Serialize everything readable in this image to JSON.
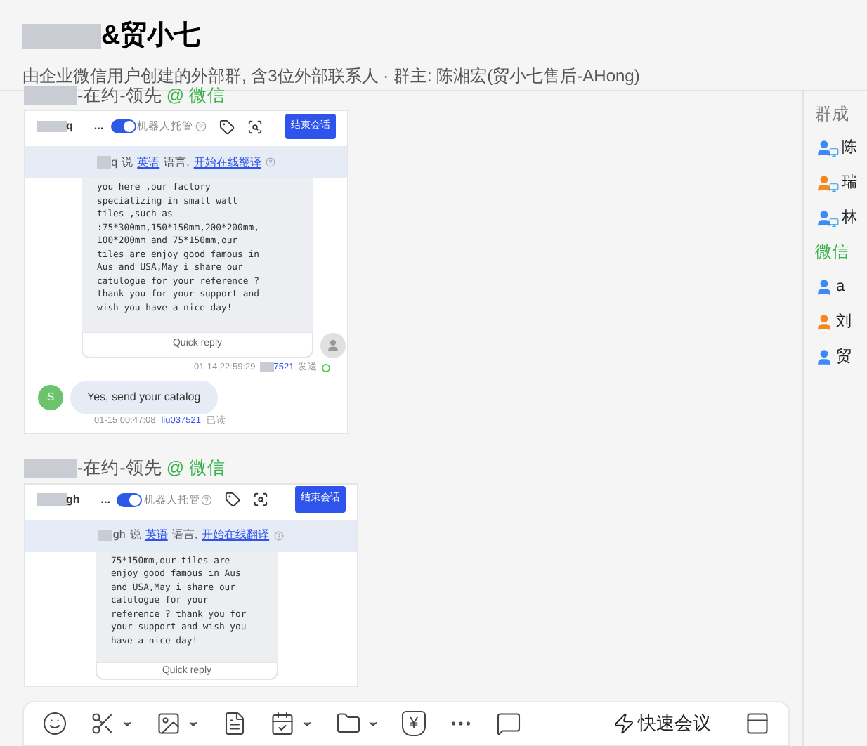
{
  "header": {
    "title": "&贸小七",
    "subtitle": "由企业微信用户创建的外部群, 含3位外部联系人 · 群主: 陈湘宏(贸小七售后-AHong)"
  },
  "posts": [
    {
      "sender": "-在约-领先",
      "channel": "@ 微信",
      "shot": {
        "contact": "q",
        "more": "...",
        "robot_on": true,
        "robot_label": "机器人托管",
        "end_button": "结束会话",
        "translate": {
          "name": "q",
          "says": "说",
          "language": "英语",
          "suffix": "语言,",
          "link": "开始在线翻译"
        },
        "lines": [
          "you here ,our factory",
          "specializing in small wall",
          "tiles ,such as",
          ":75*300mm,150*150mm,200*200mm,",
          "100*200mm and 75*150mm,our",
          "tiles are enjoy good famous in",
          "Aus and USA,May i share our",
          "catulogue for your reference ?",
          "thank you for your support and",
          "wish you have a nice day!"
        ],
        "quick_reply": "Quick reply",
        "meta": {
          "time": "01-14 22:59:29",
          "agent": "7521",
          "status": "发送"
        },
        "reply": {
          "avatar": "S",
          "text": "Yes, send your catalog",
          "time": "01-15 00:47:08",
          "agent": "liu037521",
          "status": "已读"
        }
      }
    },
    {
      "sender": "-在约-领先",
      "channel": "@ 微信",
      "shot": {
        "contact": "gh",
        "more": "...",
        "robot_on": true,
        "robot_label": "机器人托管",
        "end_button": "结束会话",
        "translate": {
          "name": "gh",
          "says": "说",
          "language": "英语",
          "suffix": "语言,",
          "link": "开始在线翻译"
        },
        "lines": [
          "75*150mm,our tiles are",
          "enjoy good famous in Aus",
          "and USA,May i share our",
          "catulogue for your",
          "reference ? thank you for",
          "your support and wish you",
          "have a nice day!"
        ],
        "quick_reply": "Quick reply"
      }
    }
  ],
  "members": {
    "title": "群成",
    "groups": [
      {
        "items": [
          {
            "name": "陈",
            "color": "#3d8af7"
          },
          {
            "name": "瑞",
            "color": "#f5891f"
          },
          {
            "name": "林",
            "color": "#3d8af7"
          }
        ]
      },
      {
        "label": "微信",
        "items": [
          {
            "name": "a",
            "color": "#3d8af7"
          },
          {
            "name": "刘",
            "color": "#f5891f"
          },
          {
            "name": "贸",
            "color": "#3d8af7"
          }
        ]
      }
    ]
  },
  "toolbar": {
    "yuan": "¥",
    "meeting": "快速会议"
  }
}
